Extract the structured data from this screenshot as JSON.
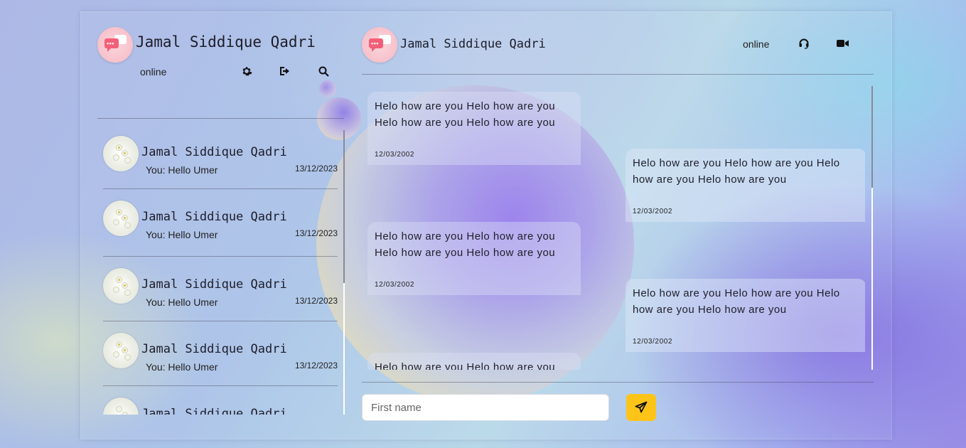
{
  "sidebar": {
    "user_name": "Jamal Siddique Qadri",
    "status": "online",
    "icons": [
      "gear-icon",
      "sign-out-icon",
      "search-icon"
    ],
    "contacts": [
      {
        "name": "Jamal Siddique Qadri",
        "last_message": "You: Hello Umer",
        "date": "13/12/2023"
      },
      {
        "name": "Jamal Siddique Qadri",
        "last_message": "You: Hello Umer",
        "date": "13/12/2023"
      },
      {
        "name": "Jamal Siddique Qadri",
        "last_message": "You: Hello Umer",
        "date": "13/12/2023"
      },
      {
        "name": "Jamal Siddique Qadri",
        "last_message": "You: Hello Umer",
        "date": "13/12/2023"
      },
      {
        "name": "Jamal Siddique Qadri",
        "last_message": "",
        "date": ""
      }
    ]
  },
  "chat": {
    "header_name": "Jamal Siddique Qadri",
    "status": "online",
    "icons": [
      "headset-icon",
      "video-icon"
    ],
    "messages": [
      {
        "side": "left",
        "text": "Helo how are you Helo how are you Helo how are you Helo how are you",
        "date": "12/03/2002"
      },
      {
        "side": "right",
        "text": "Helo how are you Helo how are you Helo how are you Helo how are you",
        "date": "12/03/2002"
      },
      {
        "side": "left",
        "text": "Helo how are you Helo how are you Helo how are you Helo how are you",
        "date": "12/03/2002"
      },
      {
        "side": "right",
        "text": "Helo how are you Helo how are you Helo how are you Helo how are you",
        "date": "12/03/2002"
      },
      {
        "side": "left",
        "text": "Helo how are you Helo how are you",
        "date": ""
      }
    ],
    "input_placeholder": "First name",
    "send_icon": "paper-plane-icon",
    "accent_color": "#fcc419"
  }
}
